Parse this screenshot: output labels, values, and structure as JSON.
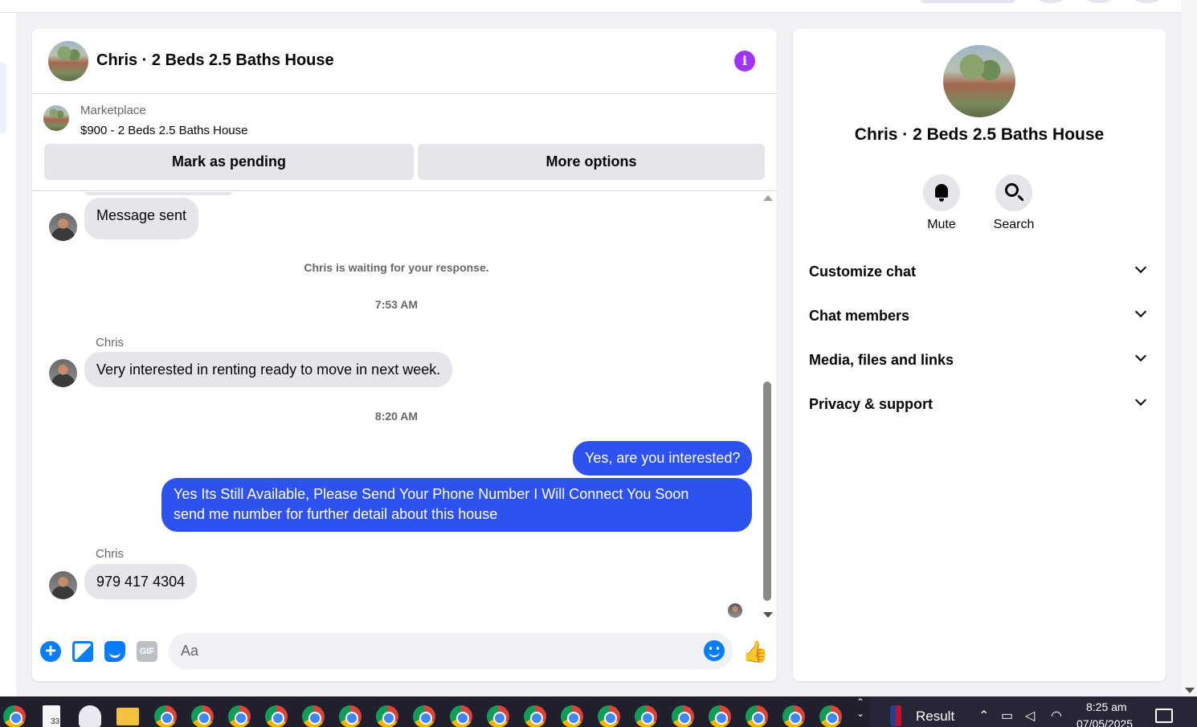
{
  "chat": {
    "title": "Chris · 2 Beds 2.5 Baths House",
    "info_icon": "info-icon",
    "listing": {
      "label": "Marketplace",
      "price_title": "$900 - 2 Beds 2.5 Baths House",
      "mark_pending_label": "Mark as pending",
      "more_options_label": "More options"
    },
    "messages": {
      "msg_sent": "Message sent",
      "waiting_note": "Chris is waiting for your response.",
      "time_1": "7:53 AM",
      "sender_1": "Chris",
      "incoming_1": "Very interested in renting ready to move in next week.",
      "time_2": "8:20 AM",
      "outgoing_1": "Yes, are you interested?",
      "outgoing_2_line1": "Yes Its Still Available, Please Send Your Phone Number I Will Connect You Soon",
      "outgoing_2_line2": "send me number for further detail about this house",
      "sender_2": "Chris",
      "incoming_2": "979 417 4304"
    },
    "composer": {
      "placeholder": "Aa",
      "gif_label": "GIF",
      "plus_glyph": "+",
      "like_glyph": "👍"
    },
    "colors": {
      "outgoing_bubble": "#2e52f2",
      "incoming_bubble": "#e4e6eb",
      "accent": "#0a7cff",
      "info": "#a033ff"
    }
  },
  "sidebar": {
    "title": "Chris · 2 Beds 2.5 Baths House",
    "actions": [
      {
        "label": "Mute",
        "icon": "bell-icon"
      },
      {
        "label": "Search",
        "icon": "search-icon"
      }
    ],
    "sections": [
      {
        "label": "Customize chat"
      },
      {
        "label": "Chat members"
      },
      {
        "label": "Media, files and links"
      },
      {
        "label": "Privacy & support"
      }
    ]
  },
  "taskbar": {
    "badge_count": "33",
    "widget_label": "Result",
    "time": "8:25 am",
    "date": "07/05/2025"
  }
}
